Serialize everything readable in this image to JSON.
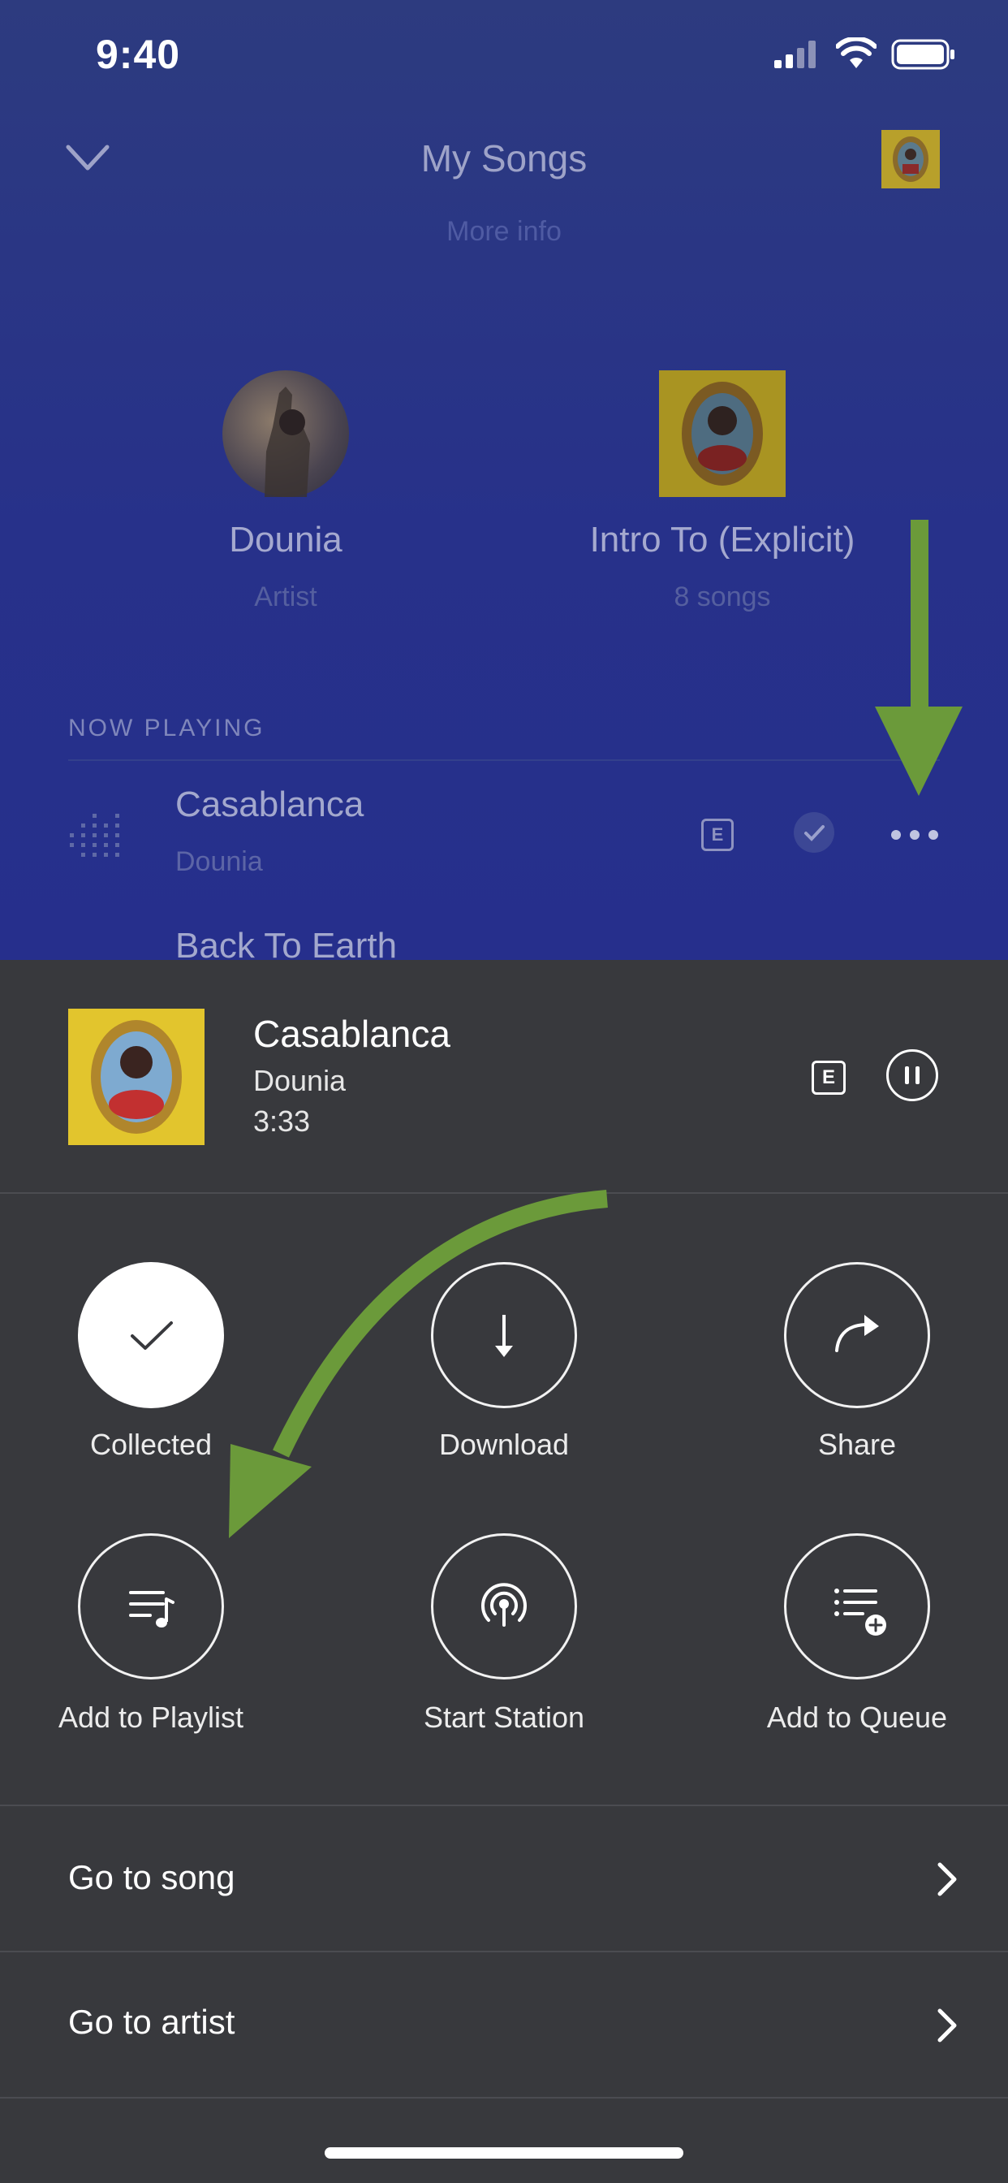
{
  "status_bar": {
    "time": "9:40"
  },
  "header": {
    "title": "My Songs",
    "subtitle": "More info"
  },
  "artist_card": {
    "name": "Dounia",
    "type": "Artist"
  },
  "album_card": {
    "name": "Intro To (Explicit)",
    "meta": "8 songs"
  },
  "now_playing": {
    "label": "NOW PLAYING",
    "current": {
      "title": "Casablanca",
      "artist": "Dounia",
      "explicit": "E"
    },
    "next": {
      "title": "Back To Earth"
    }
  },
  "sheet": {
    "track": {
      "title": "Casablanca",
      "artist": "Dounia",
      "duration": "3:33",
      "explicit": "E"
    },
    "actions": [
      {
        "label": "Collected",
        "icon": "checkmark-icon"
      },
      {
        "label": "Download",
        "icon": "download-arrow-icon"
      },
      {
        "label": "Share",
        "icon": "share-arrow-icon"
      },
      {
        "label": "Add to Playlist",
        "icon": "playlist-add-icon"
      },
      {
        "label": "Start Station",
        "icon": "radio-station-icon"
      },
      {
        "label": "Add to Queue",
        "icon": "queue-add-icon"
      }
    ],
    "rows": [
      {
        "label": "Go to song"
      },
      {
        "label": "Go to artist"
      }
    ]
  },
  "colors": {
    "top_gradient": "#27318a",
    "sheet_bg": "#38393d",
    "annotation_arrow": "#6b9a3a"
  }
}
